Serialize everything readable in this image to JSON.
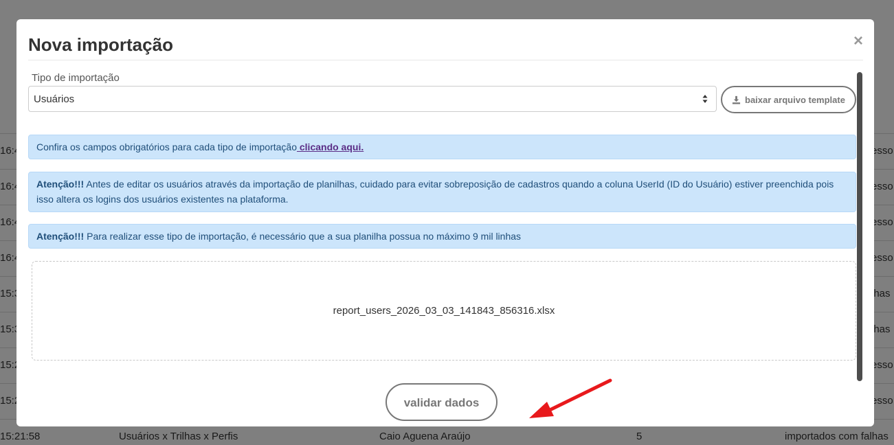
{
  "background": {
    "rows": [
      {
        "time": "16:4",
        "right": "esso"
      },
      {
        "time": "16:4",
        "right": "esso"
      },
      {
        "time": "16:4",
        "right": "esso"
      },
      {
        "time": "16:4",
        "right": "esso"
      },
      {
        "time": "15:3",
        "right": "lhas"
      },
      {
        "time": "15:3",
        "right": "lhas"
      },
      {
        "time": "15:2",
        "right": "esso"
      },
      {
        "time": "15:2",
        "right": "esso"
      }
    ],
    "last_row": {
      "time": "15:21:58",
      "type": "Usuários x Trilhas x Perfis",
      "user": "Caio Aguena Araújo",
      "count": "5",
      "status": "importados com falhas"
    }
  },
  "modal": {
    "title": "Nova importação",
    "close_symbol": "×",
    "type_label": "Tipo de importação",
    "type_value": "Usuários",
    "template_button": "baixar arquivo template",
    "alert1": {
      "text": "Confira os campos obrigatórios para cada tipo de importação",
      "link": " clicando aqui."
    },
    "alert2": {
      "bold": "Atenção!!!",
      "text": " Antes de editar os usuários através da importação de planilhas, cuidado para evitar sobreposição de cadastros quando a coluna UserId (ID do Usuário) estiver preenchida pois isso altera os logins dos usuários existentes na plataforma."
    },
    "alert3": {
      "bold": "Atenção!!!",
      "text": " Para realizar esse tipo de importação, é necessário que a sua planilha possua no máximo 9 mil linhas"
    },
    "file_name": "report_users_2026_03_03_141843_856316.xlsx",
    "validate_button": "validar dados"
  },
  "colors": {
    "alert_bg": "#cce5fb",
    "annotation_arrow": "#e8191c"
  },
  "icons": {
    "download": "download-icon",
    "select": "sort-arrows-icon",
    "close": "close-icon"
  }
}
